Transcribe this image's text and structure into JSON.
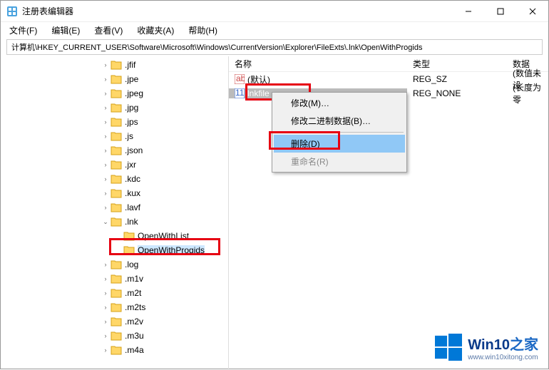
{
  "window": {
    "title": "注册表编辑器"
  },
  "menu": {
    "file": "文件(F)",
    "edit": "编辑(E)",
    "view": "查看(V)",
    "favorites": "收藏夹(A)",
    "help": "帮助(H)"
  },
  "address": "计算机\\HKEY_CURRENT_USER\\Software\\Microsoft\\Windows\\CurrentVersion\\Explorer\\FileExts\\.lnk\\OpenWithProgids",
  "tree": [
    {
      "label": ".jfif",
      "expand": ">"
    },
    {
      "label": ".jpe",
      "expand": ">"
    },
    {
      "label": ".jpeg",
      "expand": ">"
    },
    {
      "label": ".jpg",
      "expand": ">"
    },
    {
      "label": ".jps",
      "expand": ">"
    },
    {
      "label": ".js",
      "expand": ">"
    },
    {
      "label": ".json",
      "expand": ">"
    },
    {
      "label": ".jxr",
      "expand": ">"
    },
    {
      "label": ".kdc",
      "expand": ">"
    },
    {
      "label": ".kux",
      "expand": ">"
    },
    {
      "label": ".lavf",
      "expand": ">"
    },
    {
      "label": ".lnk",
      "expand": "v",
      "children": [
        {
          "label": "OpenWithList"
        },
        {
          "label": "OpenWithProgids",
          "selected": true
        }
      ]
    },
    {
      "label": ".log",
      "expand": ">"
    },
    {
      "label": ".m1v",
      "expand": ">"
    },
    {
      "label": ".m2t",
      "expand": ">"
    },
    {
      "label": ".m2ts",
      "expand": ">"
    },
    {
      "label": ".m2v",
      "expand": ">"
    },
    {
      "label": ".m3u",
      "expand": ">"
    },
    {
      "label": ".m4a",
      "expand": ">"
    }
  ],
  "list": {
    "headers": {
      "name": "名称",
      "type": "类型",
      "data": "数据"
    },
    "rows": [
      {
        "name": "(默认)",
        "type": "REG_SZ",
        "data": "(数值未设",
        "kind": "string"
      },
      {
        "name": "lnkfile",
        "type": "REG_NONE",
        "data": "(长度为零",
        "selected": true,
        "kind": "binary"
      }
    ]
  },
  "context": {
    "modify": "修改(M)…",
    "modbin": "修改二进制数据(B)…",
    "delete": "删除(D)",
    "rename": "重命名(R)"
  },
  "watermark": {
    "brand": "Win10",
    "brand2": "之家",
    "url": "www.win10xitong.com"
  }
}
